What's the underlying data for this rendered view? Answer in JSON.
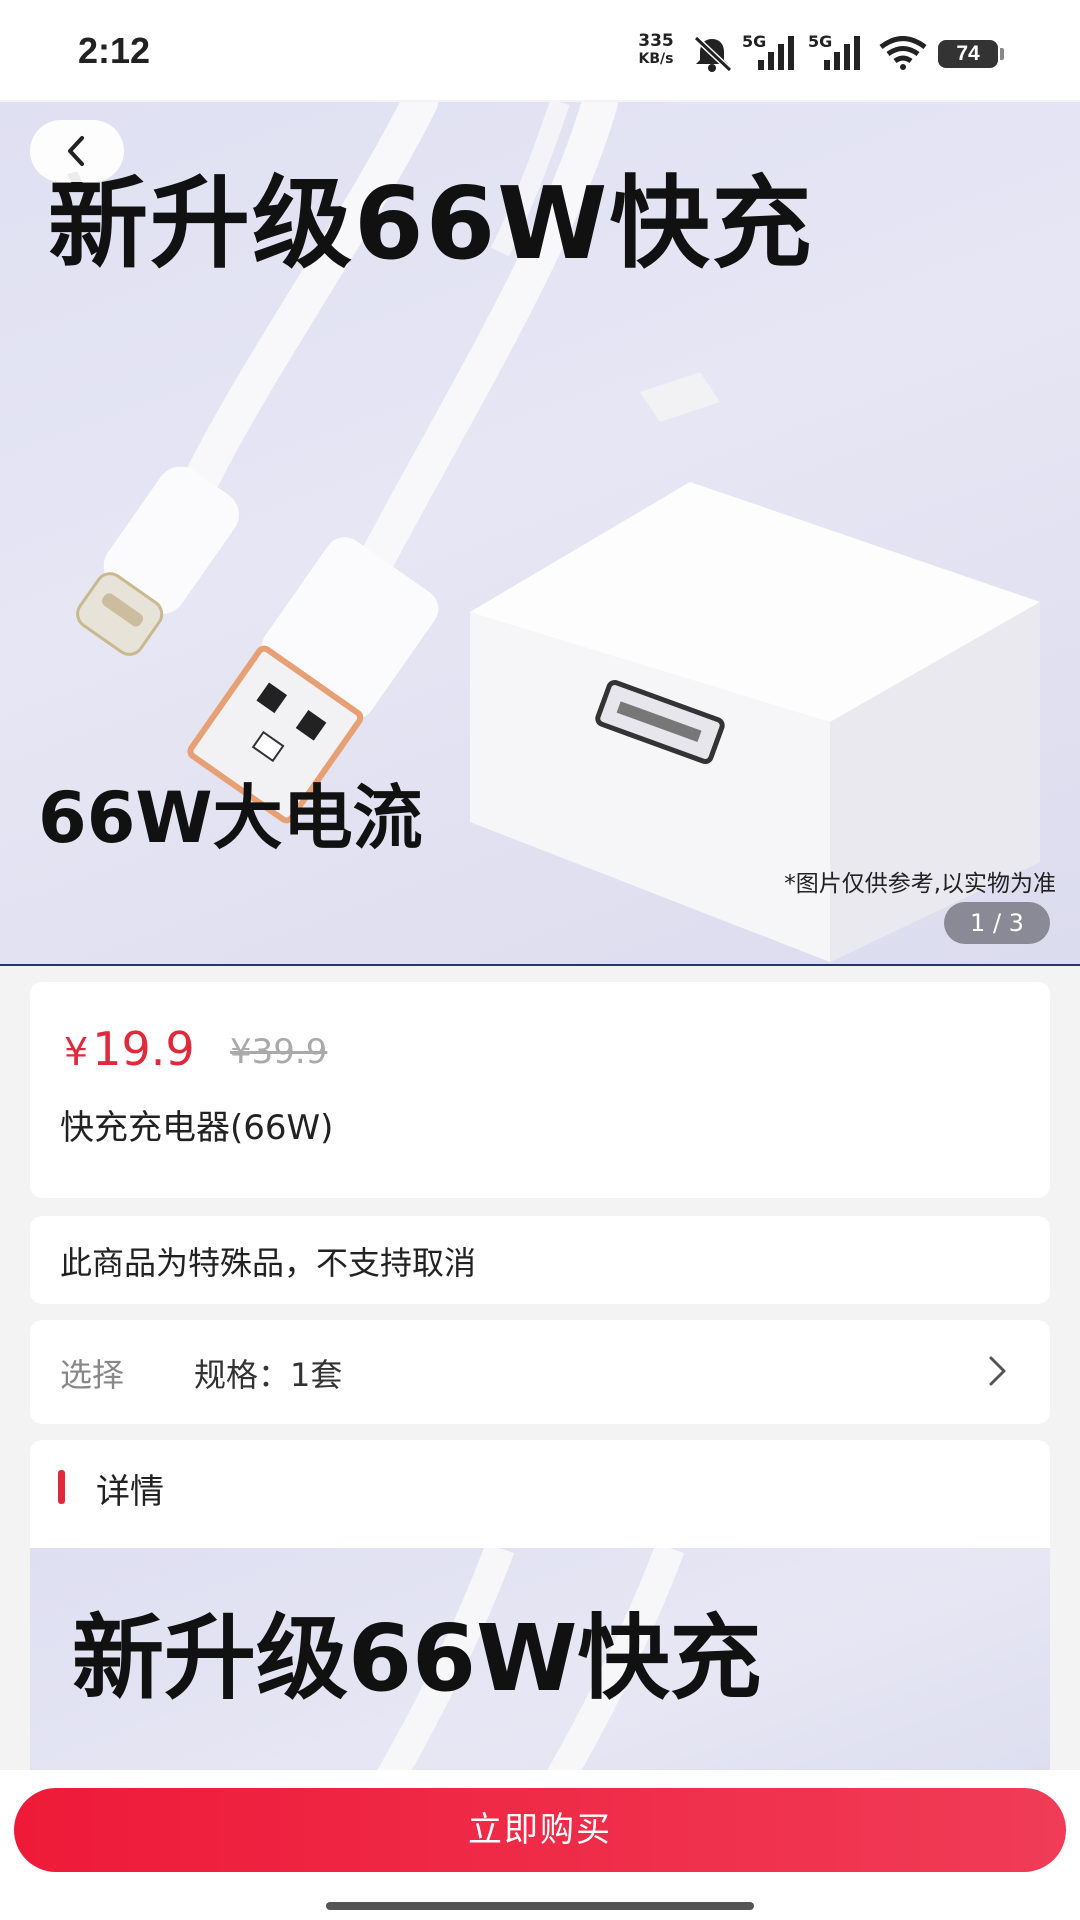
{
  "status_bar": {
    "time": "2:12",
    "net_speed_value": "335",
    "net_speed_unit": "KB/s",
    "signal_1": "5G",
    "signal_2": "5G",
    "battery": "74"
  },
  "hero": {
    "headline": "新升级66W快充",
    "subheadline": "66W大电流",
    "note": "*图片仅供参考,以实物为准",
    "pager": "1 / 3"
  },
  "product": {
    "currency": "¥",
    "price": "19.9",
    "original_price": "¥39.9",
    "name": "快充充电器(66W)"
  },
  "notice": "此商品为特殊品，不支持取消",
  "selection": {
    "label": "选择",
    "value": "规格：1套"
  },
  "detail": {
    "title": "详情",
    "image_headline": "新升级66W快充"
  },
  "buy_button": "立即购买",
  "colors": {
    "accent": "#e02a3c",
    "buy_button": "#ee1a38"
  }
}
